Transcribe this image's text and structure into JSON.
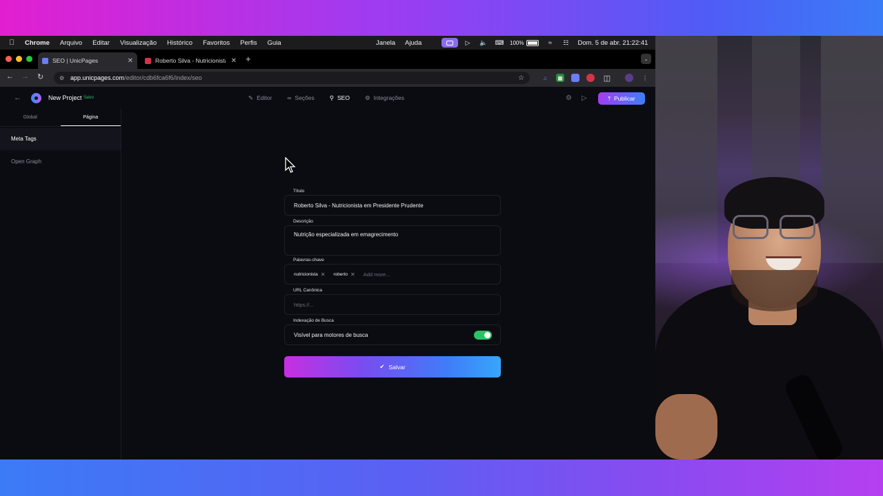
{
  "menubar": {
    "apple": "",
    "app_name": "Chrome",
    "items": [
      "Arquivo",
      "Editar",
      "Visualização",
      "Histórico",
      "Favoritos",
      "Perfis",
      "Guia"
    ],
    "right_items": [
      "Janela",
      "Ajuda"
    ],
    "battery": "100%",
    "datetime": "Dom. 5 de abr.  21:22:41"
  },
  "browser": {
    "tabs": [
      {
        "title": "SEO | UnicPages",
        "favicon_color": "#6c7cf7",
        "active": true
      },
      {
        "title": "Roberto Silva - Nutricionista e",
        "favicon_color": "#d8324a",
        "active": false
      }
    ],
    "url_host": "app.unicpages.com",
    "url_path": "/editor/cdb6fca6f6/index/seo"
  },
  "app": {
    "project_name": "New Project",
    "saved_status": "Salvo",
    "nav": [
      {
        "label": "Editor",
        "icon": "pencil-icon",
        "active": false
      },
      {
        "label": "Seções",
        "icon": "link-icon",
        "active": false
      },
      {
        "label": "SEO",
        "icon": "search-icon",
        "active": true
      },
      {
        "label": "Integrações",
        "icon": "gear-icon",
        "active": false
      }
    ],
    "publish_label": "Publicar",
    "accent_colors": {
      "publish_start": "#a53df0",
      "publish_end": "#3b7ff8",
      "toggle_on": "#27c466"
    }
  },
  "sidebar": {
    "tabs": [
      "Global",
      "Página"
    ],
    "active_tab": "Página",
    "items": [
      "Meta Tags",
      "Open Graph"
    ]
  },
  "form": {
    "title_label": "Título",
    "title_value": "Roberto Silva - Nutricionista em Presidente Prudente",
    "description_label": "Descrição",
    "description_value": "Nutrição especializada em emagrecimento",
    "keywords_label": "Palavras-chave",
    "keywords": [
      "nutricionista",
      "roberto"
    ],
    "keywords_placeholder": "Add more...",
    "canonical_label": "URL Canônica",
    "canonical_placeholder": "https://...",
    "indexing_label": "Indexação de Busca",
    "indexing_text": "Visível para motores de busca",
    "indexing_enabled": true,
    "save_label": "Salvar"
  }
}
